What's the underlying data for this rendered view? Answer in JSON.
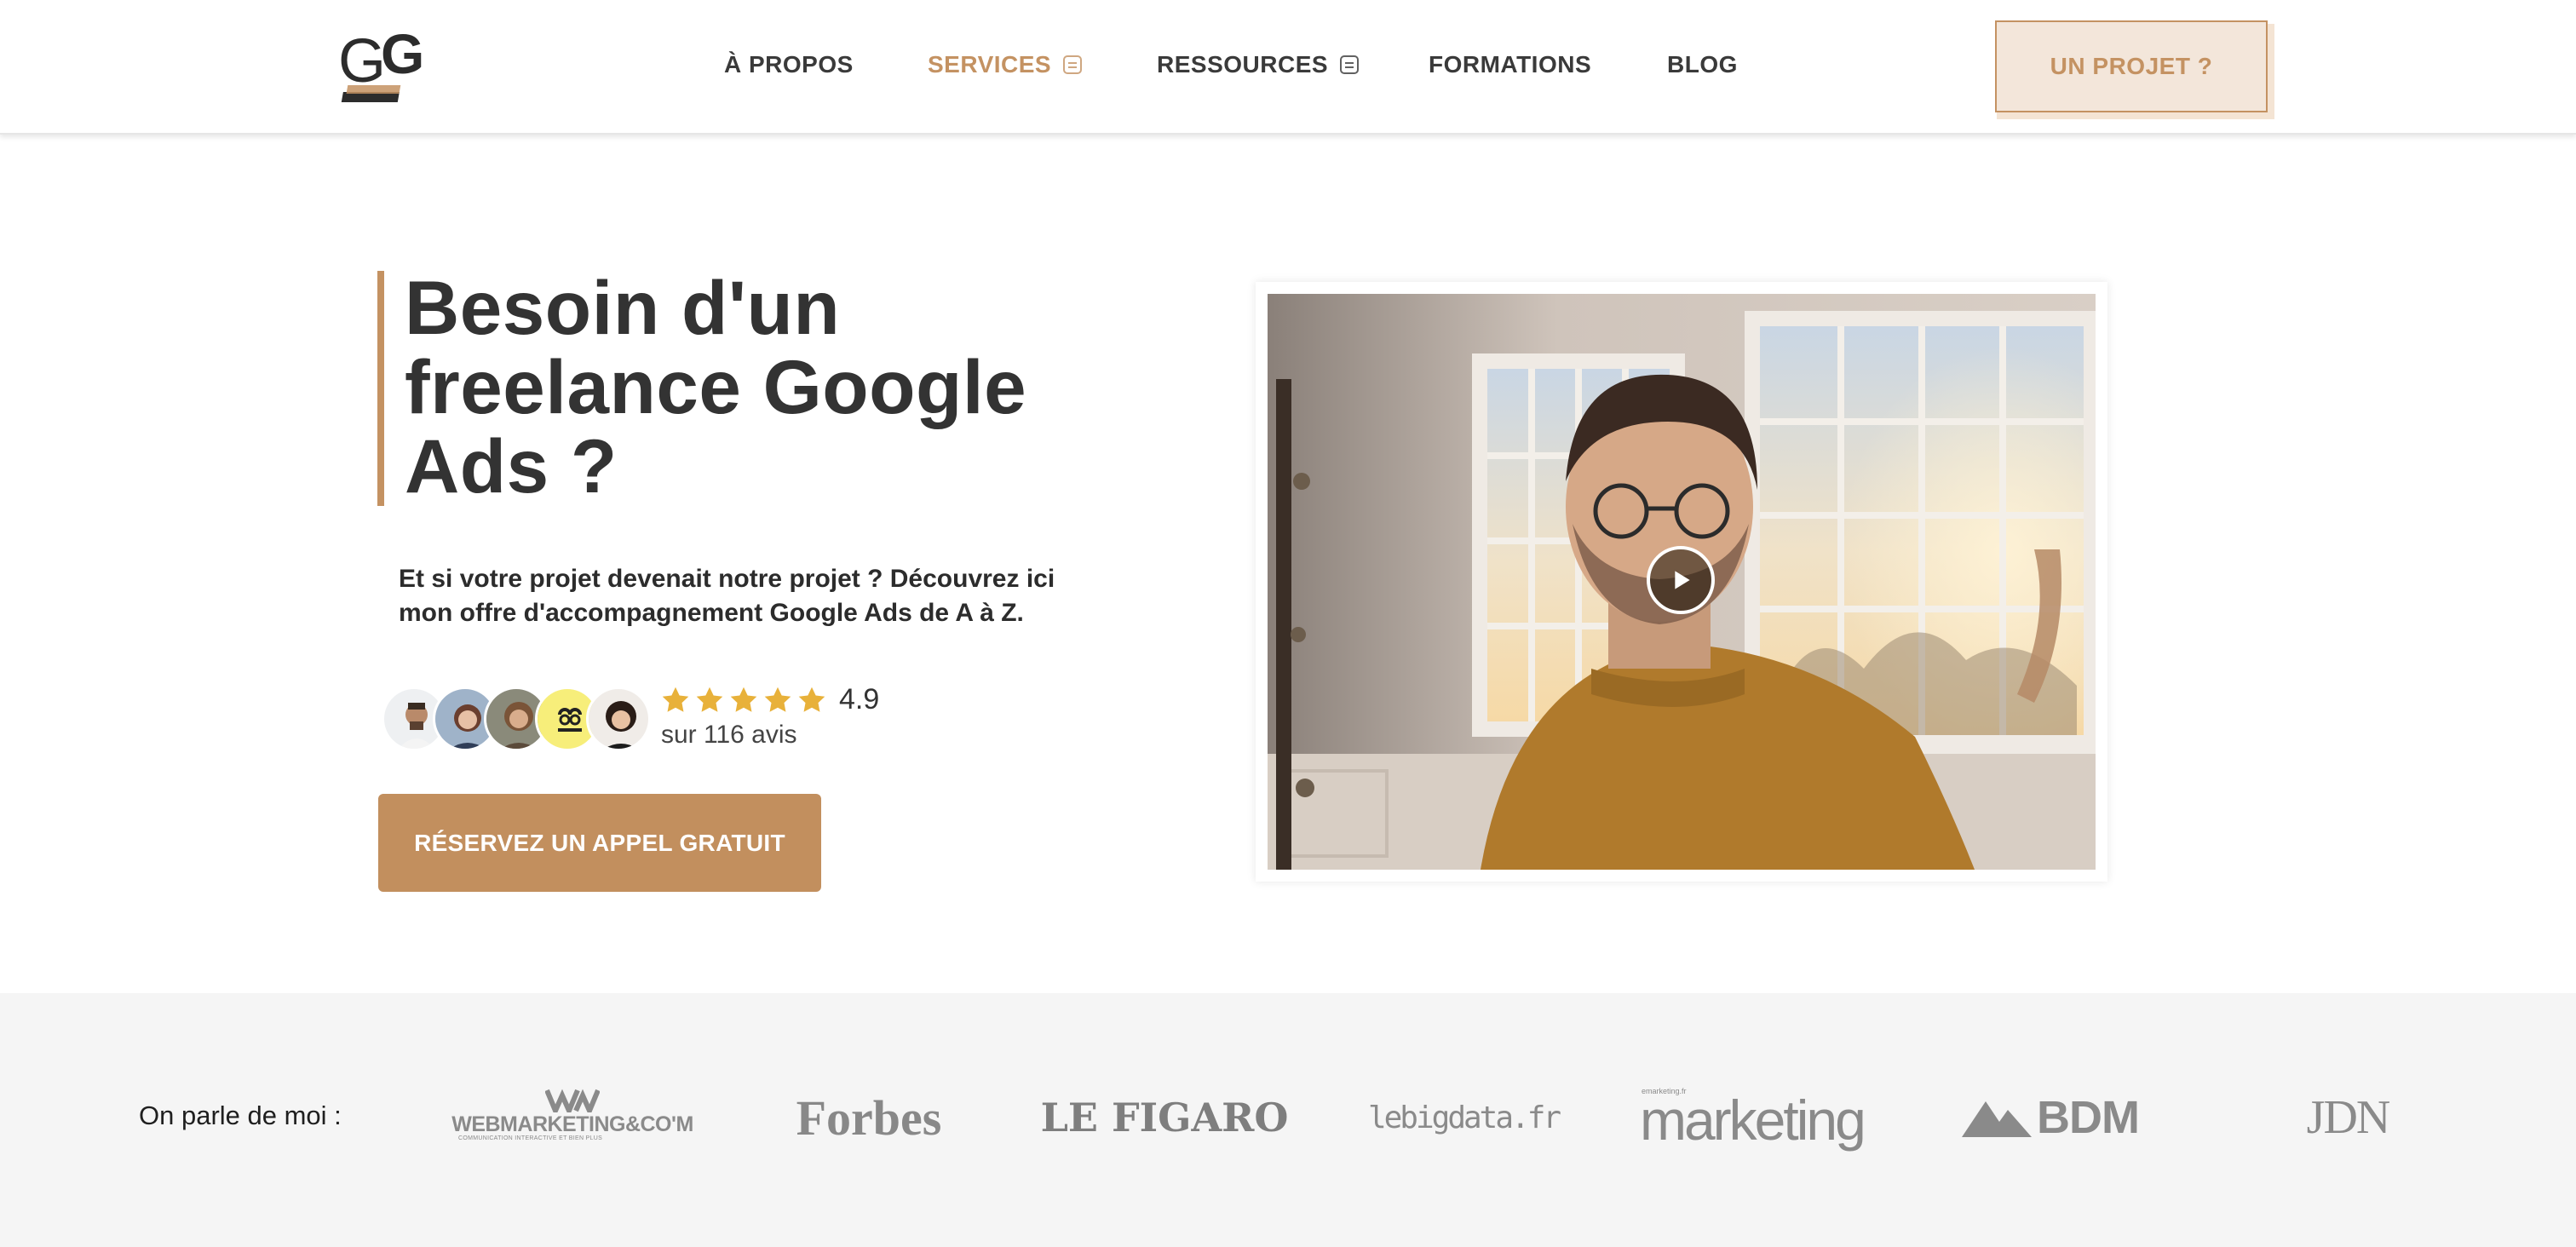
{
  "header": {
    "logo_text": "GG",
    "nav": [
      {
        "label": "À PROPOS",
        "active": false,
        "has_icon": false
      },
      {
        "label": "SERVICES",
        "active": true,
        "has_icon": true
      },
      {
        "label": "RESSOURCES",
        "active": false,
        "has_icon": true
      },
      {
        "label": "FORMATIONS",
        "active": false,
        "has_icon": false
      },
      {
        "label": "BLOG",
        "active": false,
        "has_icon": false
      }
    ],
    "cta_label": "UN PROJET ?"
  },
  "hero": {
    "title": "Besoin d'un freelance Google Ads ?",
    "title_lines": [
      "Besoin d'un",
      "freelance Google",
      "Ads ?"
    ],
    "subtitle": "Et si votre projet devenait notre projet ? Découvrez ici mon offre d'accompagnement Google Ads de A à Z.",
    "rating_value": "4.9",
    "stars_count": 5,
    "reviews_text": "sur 116 avis",
    "cta_label": "RÉSERVEZ UN APPEL GRATUIT"
  },
  "video": {
    "play_icon": "play-icon"
  },
  "press": {
    "label": "On parle de moi :",
    "logos": [
      "WEBMARKETING&CO'M",
      "Forbes",
      "LE FIGARO",
      "lebigdata.fr",
      "marketing",
      "BDM",
      "JDN"
    ],
    "webmarketing_tagline": "COMMUNICATION INTERACTIVE ET BIEN PLUS",
    "marketing_prefix": "emarketing.fr"
  },
  "colors": {
    "accent": "#c49262",
    "cta_bg": "#c28f5e",
    "cta_top_bg": "#f3e6da",
    "title": "#333333",
    "press_bg": "#f5f5f5",
    "star": "#e8b13a"
  }
}
